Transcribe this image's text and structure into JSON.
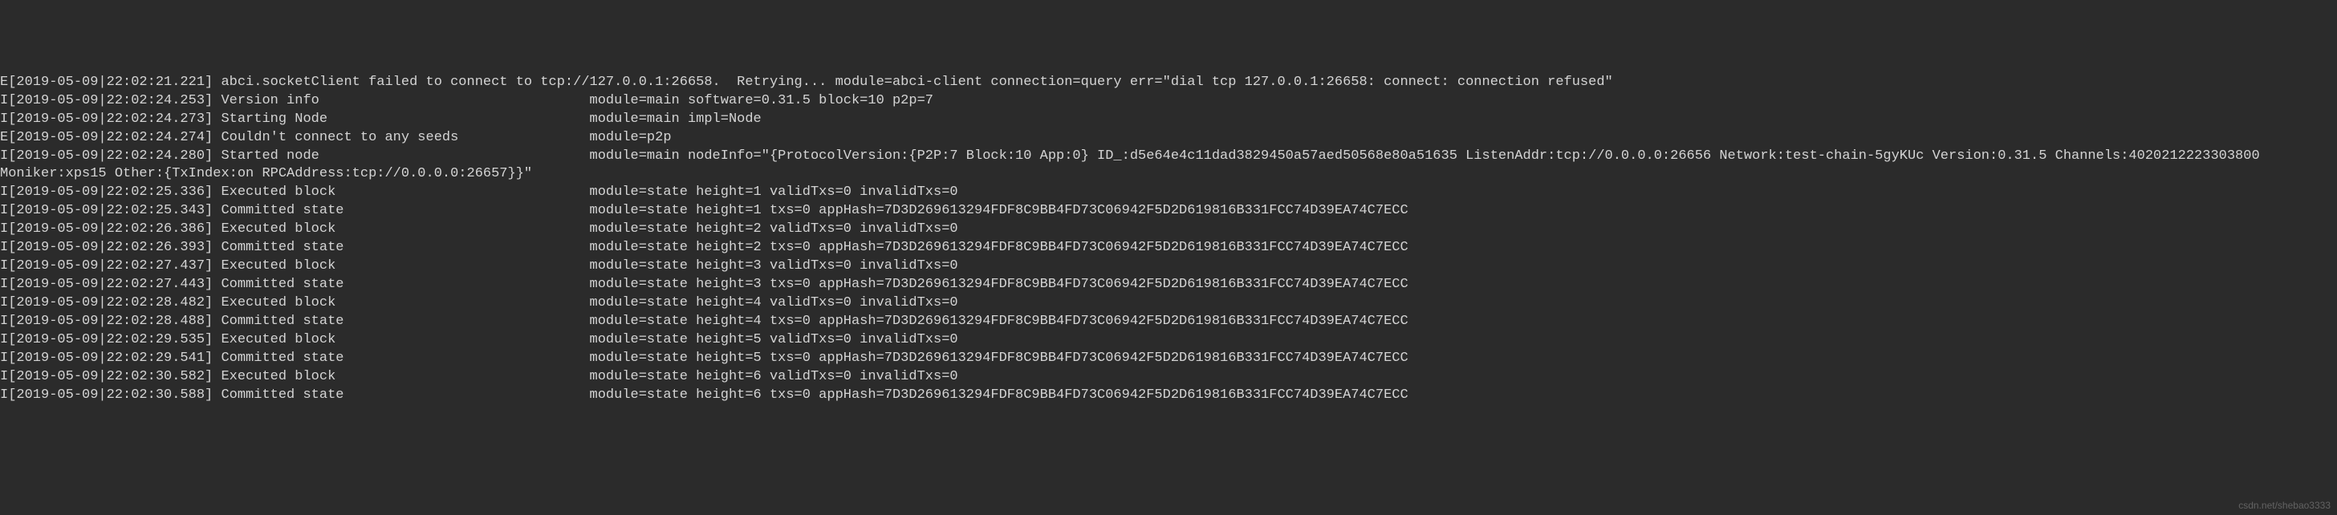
{
  "lines": [
    "E[2019-05-09|22:02:21.221] abci.socketClient failed to connect to tcp://127.0.0.1:26658.  Retrying... module=abci-client connection=query err=\"dial tcp 127.0.0.1:26658: connect: connection refused\"",
    "I[2019-05-09|22:02:24.253] Version info                                 module=main software=0.31.5 block=10 p2p=7",
    "I[2019-05-09|22:02:24.273] Starting Node                                module=main impl=Node",
    "E[2019-05-09|22:02:24.274] Couldn't connect to any seeds                module=p2p",
    "I[2019-05-09|22:02:24.280] Started node                                 module=main nodeInfo=\"{ProtocolVersion:{P2P:7 Block:10 App:0} ID_:d5e64e4c11dad3829450a57aed50568e80a51635 ListenAddr:tcp://0.0.0.0:26656 Network:test-chain-5gyKUc Version:0.31.5 Channels:4020212223303800 Moniker:xps15 Other:{TxIndex:on RPCAddress:tcp://0.0.0.0:26657}}\"",
    "I[2019-05-09|22:02:25.336] Executed block                               module=state height=1 validTxs=0 invalidTxs=0",
    "I[2019-05-09|22:02:25.343] Committed state                              module=state height=1 txs=0 appHash=7D3D269613294FDF8C9BB4FD73C06942F5D2D619816B331FCC74D39EA74C7ECC",
    "I[2019-05-09|22:02:26.386] Executed block                               module=state height=2 validTxs=0 invalidTxs=0",
    "I[2019-05-09|22:02:26.393] Committed state                              module=state height=2 txs=0 appHash=7D3D269613294FDF8C9BB4FD73C06942F5D2D619816B331FCC74D39EA74C7ECC",
    "I[2019-05-09|22:02:27.437] Executed block                               module=state height=3 validTxs=0 invalidTxs=0",
    "I[2019-05-09|22:02:27.443] Committed state                              module=state height=3 txs=0 appHash=7D3D269613294FDF8C9BB4FD73C06942F5D2D619816B331FCC74D39EA74C7ECC",
    "I[2019-05-09|22:02:28.482] Executed block                               module=state height=4 validTxs=0 invalidTxs=0",
    "I[2019-05-09|22:02:28.488] Committed state                              module=state height=4 txs=0 appHash=7D3D269613294FDF8C9BB4FD73C06942F5D2D619816B331FCC74D39EA74C7ECC",
    "I[2019-05-09|22:02:29.535] Executed block                               module=state height=5 validTxs=0 invalidTxs=0",
    "I[2019-05-09|22:02:29.541] Committed state                              module=state height=5 txs=0 appHash=7D3D269613294FDF8C9BB4FD73C06942F5D2D619816B331FCC74D39EA74C7ECC",
    "I[2019-05-09|22:02:30.582] Executed block                               module=state height=6 validTxs=0 invalidTxs=0",
    "I[2019-05-09|22:02:30.588] Committed state                              module=state height=6 txs=0 appHash=7D3D269613294FDF8C9BB4FD73C06942F5D2D619816B331FCC74D39EA74C7ECC"
  ],
  "watermark": "csdn.net/shebao3333"
}
